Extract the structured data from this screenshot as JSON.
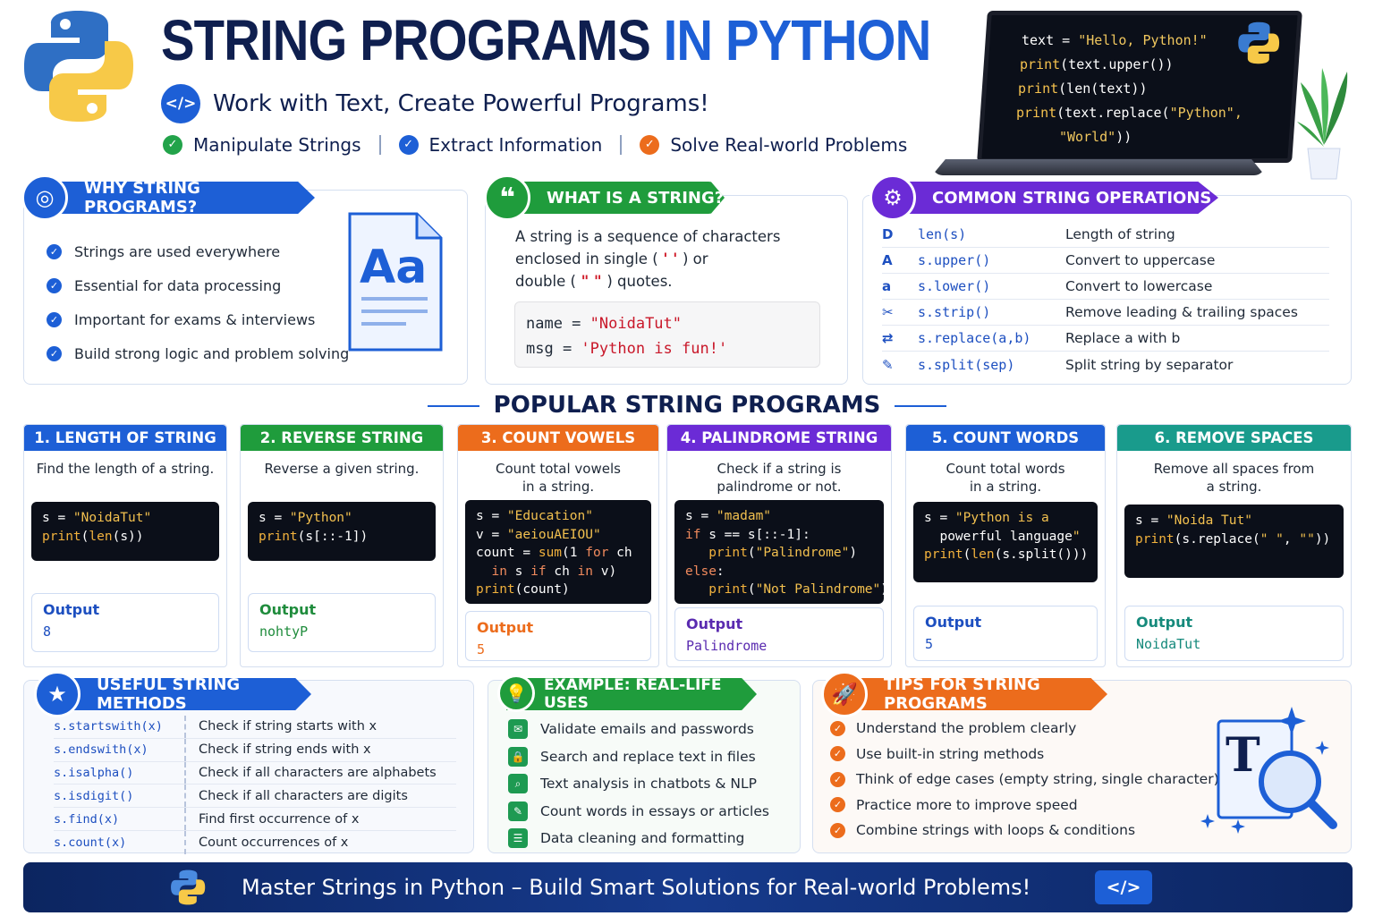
{
  "header": {
    "title_main": "STRING PROGRAMS",
    "title_accent": "IN PYTHON",
    "subtitle": "Work with Text, Create Powerful Programs!",
    "code_icon": "</>",
    "features": [
      "Manipulate Strings",
      "Extract Information",
      "Solve Real-world Problems"
    ]
  },
  "laptop_code": [
    {
      "a": "text = ",
      "b": "\"Hello, Python!\"",
      "c": ""
    },
    {
      "a": "print",
      "b": "(text.upper())",
      "c": ""
    },
    {
      "a": "print",
      "b": "(len(text))",
      "c": ""
    },
    {
      "a": "print",
      "b": "(text.replace(",
      "c": "\"Python\","
    },
    {
      "a": "",
      "b": "\"World\"",
      "c": "))"
    }
  ],
  "why": {
    "title": "WHY STRING PROGRAMS?",
    "items": [
      "Strings are used everywhere",
      "Essential for data processing",
      "Important for exams & interviews",
      "Build strong logic and problem solving"
    ],
    "doc_glyph": "Aa"
  },
  "what": {
    "title": "WHAT IS A STRING?",
    "line1": "A string is a sequence of characters",
    "line2a": "enclosed in single (",
    "single_q": " ' ' ",
    "line2b": ") or",
    "line3a": "double (",
    "double_q": " \" \" ",
    "line3b": ") quotes.",
    "code1_var": "name  =  ",
    "code1_val": "\"NoidaTut\"",
    "code2_var": "msg  =  ",
    "code2_val": "'Python is fun!'"
  },
  "ops": {
    "title": "COMMON STRING OPERATIONS",
    "rows": [
      {
        "icon": "D",
        "code": "len(s)",
        "desc": "Length of string"
      },
      {
        "icon": "A",
        "code": "s.upper()",
        "desc": "Convert to uppercase"
      },
      {
        "icon": "a",
        "code": "s.lower()",
        "desc": "Convert to lowercase"
      },
      {
        "icon": "✂",
        "code": "s.strip()",
        "desc": "Remove leading & trailing spaces"
      },
      {
        "icon": "⇄",
        "code": "s.replace(a,b)",
        "desc": "Replace a with b"
      },
      {
        "icon": "✎",
        "code": "s.split(sep)",
        "desc": "Split string by separator"
      }
    ]
  },
  "popular_title": "POPULAR STRING PROGRAMS",
  "programs": [
    {
      "title": "1. LENGTH OF STRING",
      "desc": "Find the length of a string.",
      "color": "#1d5fd6",
      "code": [
        "s = \"NoidaTut\"",
        "print(len(s))"
      ],
      "out_label": "Output",
      "out_value": "8"
    },
    {
      "title": "2. REVERSE STRING",
      "desc": "Reverse a given string.",
      "color": "#1f9c3c",
      "code": [
        "s = \"Python\"",
        "print(s[::-1])"
      ],
      "out_label": "Output",
      "out_value": "nohtyP"
    },
    {
      "title": "3. COUNT VOWELS",
      "desc": "Count total vowels in a string.",
      "color": "#ec6c1c",
      "code": [
        "s = \"Education\"",
        "v = \"aeiouAEIOU\"",
        "count = sum(1 for ch",
        "  in s if ch in v)",
        "print(count)"
      ],
      "out_label": "Output",
      "out_value": "5"
    },
    {
      "title": "4. PALINDROME STRING",
      "desc": "Check if a string is palindrome or not.",
      "color": "#6b2bd6",
      "code": [
        "s = \"madam\"",
        "if s == s[::-1]:",
        "   print(\"Palindrome\")",
        "else:",
        "   print(\"Not Palindrome\")"
      ],
      "out_label": "Output",
      "out_value": "Palindrome"
    },
    {
      "title": "5. COUNT WORDS",
      "desc": "Count total words in a string.",
      "color": "#1d5fd6",
      "code": [
        "s = \"Python is a",
        "  powerful language\"",
        "print(len(s.split()))"
      ],
      "out_label": "Output",
      "out_value": "5"
    },
    {
      "title": "6. REMOVE SPACES",
      "desc": "Remove all spaces from a string.",
      "color": "#199b8c",
      "code": [
        "s = \"Noida Tut\"",
        "print(s.replace(\" \", \"\"))"
      ],
      "out_label": "Output",
      "out_value": "NoidaTut"
    }
  ],
  "methods": {
    "title": "USEFUL STRING METHODS",
    "rows": [
      {
        "code": "s.startswith(x)",
        "desc": "Check if string starts with x"
      },
      {
        "code": "s.endswith(x)",
        "desc": "Check if string ends with x"
      },
      {
        "code": "s.isalpha()",
        "desc": "Check if all characters are alphabets"
      },
      {
        "code": "s.isdigit()",
        "desc": "Check if all characters are digits"
      },
      {
        "code": "s.find(x)",
        "desc": "Find first occurrence of x"
      },
      {
        "code": "s.count(x)",
        "desc": "Count occurrences of x"
      }
    ]
  },
  "uses": {
    "title": "EXAMPLE: REAL-LIFE USES",
    "items": [
      {
        "icon": "✉",
        "text": "Validate emails and passwords"
      },
      {
        "icon": "🔒",
        "text": "Search and replace text in files"
      },
      {
        "icon": "⌕",
        "text": "Text analysis in chatbots & NLP"
      },
      {
        "icon": "✎",
        "text": "Count words in essays or articles"
      },
      {
        "icon": "☰",
        "text": "Data cleaning and formatting"
      }
    ]
  },
  "tips": {
    "title": "TIPS FOR STRING PROGRAMS",
    "items": [
      "Understand the problem clearly",
      "Use built-in string methods",
      "Think of edge cases (empty string, single character)",
      "Practice more to improve speed",
      "Combine strings with loops & conditions"
    ],
    "icon_glyph": "T"
  },
  "footer": {
    "text": "Master Strings in Python – Build Smart Solutions for Real-world Problems!",
    "code_icon": "</>"
  },
  "colors": {
    "primary": "#1d5fd6",
    "navy": "#0f1f4f",
    "green": "#1f9c3c",
    "orange": "#ec6c1c",
    "purple": "#6b2bd6",
    "teal": "#199b8c"
  }
}
